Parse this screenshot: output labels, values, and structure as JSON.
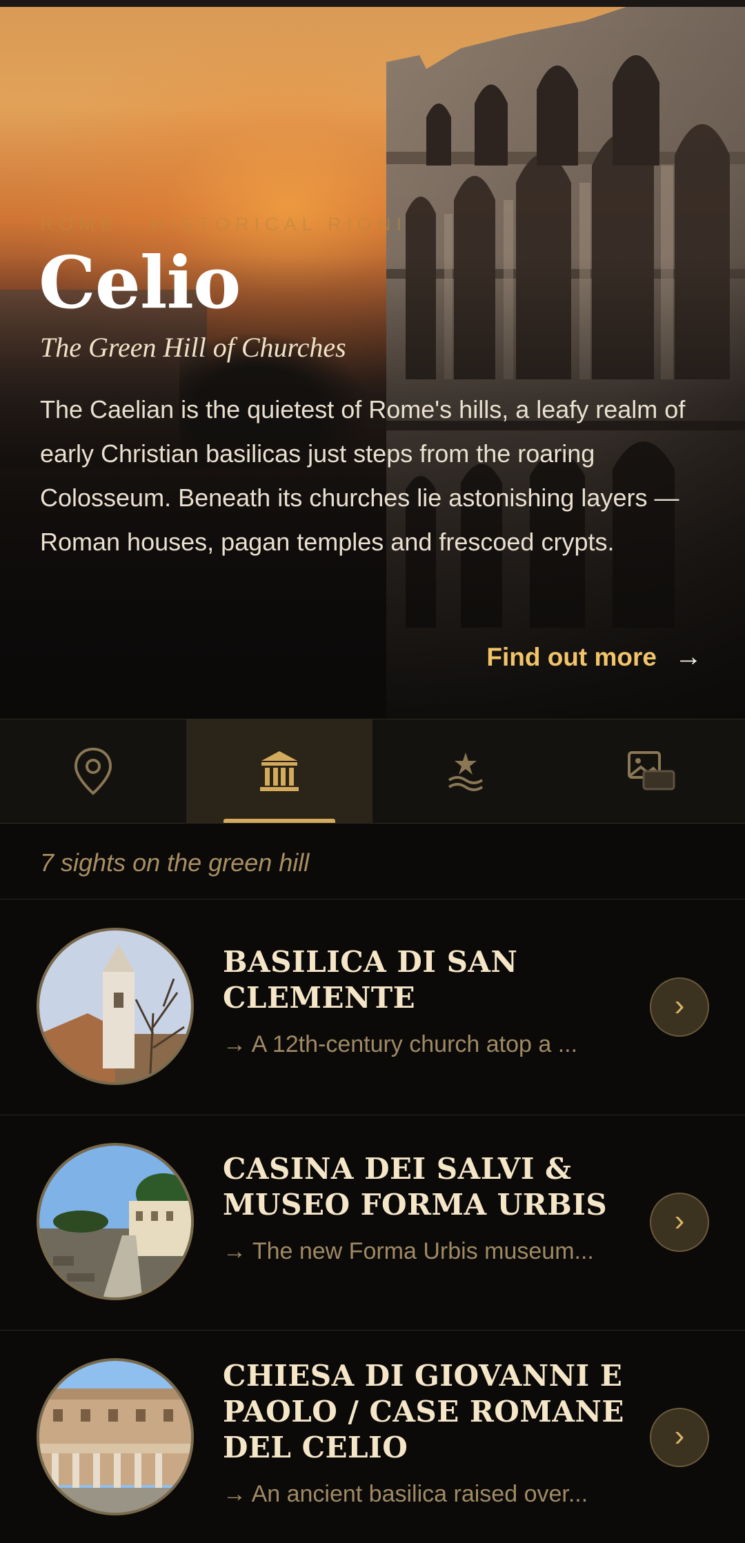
{
  "hero": {
    "kicker": "Rome · Historical Rioni",
    "title": "Celio",
    "subtitle": "The Green Hill of Churches",
    "description": "The Caelian is the quietest of Rome's hills, a leafy realm of early Christian basilicas just steps from the roaring Colosseum. Beneath its churches lie astonishing layers — Roman houses, pagan temples and frescoed crypts.",
    "cta_label": "Find out more",
    "cta_arrow": "→"
  },
  "tabs": [
    {
      "icon": "map-pin-icon",
      "active": false
    },
    {
      "icon": "monument-icon",
      "active": true
    },
    {
      "icon": "star-waves-icon",
      "active": false
    },
    {
      "icon": "gallery-icon",
      "active": false
    }
  ],
  "sights": {
    "count_label": "7 sights on the green hill",
    "items": [
      {
        "title": "Basilica di San Clemente",
        "desc": "→ A 12th-century church atop a ...",
        "chevron": "›"
      },
      {
        "title": "Casina dei Salvi & Museo Forma Urbis",
        "desc": "→ The new Forma Urbis museum...",
        "chevron": "›"
      },
      {
        "title": "Chiesa di Giovanni e Paolo / Case Romane del Celio",
        "desc": "→ An ancient basilica raised over...",
        "chevron": "›"
      }
    ]
  },
  "colors": {
    "accent_gold": "#d4aa5c",
    "cta": "#f2c46a",
    "background": "#0b0a09"
  }
}
